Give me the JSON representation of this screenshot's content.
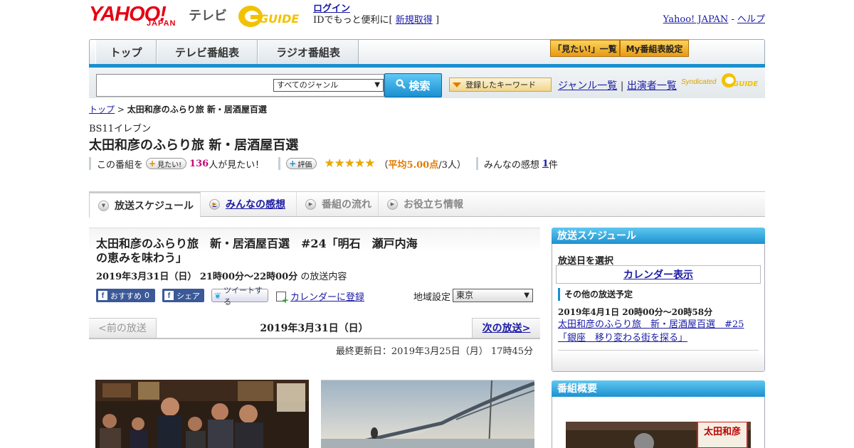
{
  "header": {
    "logo_yahoo": "YAHOO!",
    "logo_japan": "JAPAN",
    "logo_tv": "テレビ",
    "logo_gguide": "GUIDE",
    "login_label": "ログイン",
    "id_text": "IDでもっと便利に[",
    "signup_label": "新規取得",
    "id_text_end": "]",
    "yahoo_japan_link": "Yahoo! JAPAN",
    "dash": "-",
    "help_link": "ヘルプ"
  },
  "nav": {
    "tabs": [
      {
        "label": "トップ"
      },
      {
        "label": "テレビ番組表"
      },
      {
        "label": "ラジオ番組表"
      }
    ],
    "mitai_list": "「見たい!」一覧",
    "my_schedule": "My番組表設定"
  },
  "search": {
    "genre_value": "すべてのジャンル",
    "search_button": "検索",
    "keyword_button": "登録したキーワード",
    "genre_list_link": "ジャンル一覧",
    "separator": "|",
    "performers_link": "出演者一覧",
    "syndicated": "Syndicated",
    "gguide_small": "GUIDE"
  },
  "breadcrumb": {
    "top": "トップ",
    "sep": ">",
    "current": "太田和彦のふらり旅 新・居酒屋百選"
  },
  "program": {
    "station": "BS11イレブン",
    "title": "太田和彦のふらり旅 新・居酒屋百選",
    "this_program": "この番組を",
    "mitai_button": "見たい!",
    "mitai_count": "136",
    "mitai_suffix": "人が見たい！",
    "rating_button": "評価",
    "stars": "★★★★★",
    "rating_open": "（",
    "rating_avg": "平均5.00点",
    "rating_count": "/3人）",
    "impressions_label": "みんなの感想",
    "impressions_count": "1",
    "impressions_suffix": "件"
  },
  "subtabs": [
    {
      "label": "放送スケジュール"
    },
    {
      "label": "みんなの感想"
    },
    {
      "label": "番組の流れ"
    },
    {
      "label": "お役立ち情報"
    }
  ],
  "episode": {
    "title": "太田和彦のふらり旅　新・居酒屋百選　#24「明石　瀬戸内海の恵みを味わう」",
    "datetime": "2019年3月31日（日） 21時00分～22時00分",
    "datetime_suffix": "の放送内容",
    "fb_recommend": "おすすめ",
    "fb_count": "0",
    "fb_share": "シェア",
    "tweet": "ツイートする",
    "calendar_register": "カレンダーに登録",
    "region_label": "地域設定",
    "region_value": "東京"
  },
  "datenav": {
    "prev": "<前の放送",
    "current": "2019年3月31日（日）",
    "next": "次の放送>"
  },
  "updated": "最終更新日：2019年3月25日（月） 17時45分",
  "sidebar": {
    "schedule_title": "放送スケジュール",
    "select_date": "放送日を選択",
    "calendar_display": "カレンダー表示",
    "other_schedule": "その他の放送予定",
    "other_time": "2019年4月1日 20時00分～20時58分",
    "other_title": "太田和彦のふらり旅　新・居酒屋百選　#25「銀座　移り変わる街を探る」",
    "overview_title": "番組概要",
    "overview_sign": "太田和彦"
  }
}
